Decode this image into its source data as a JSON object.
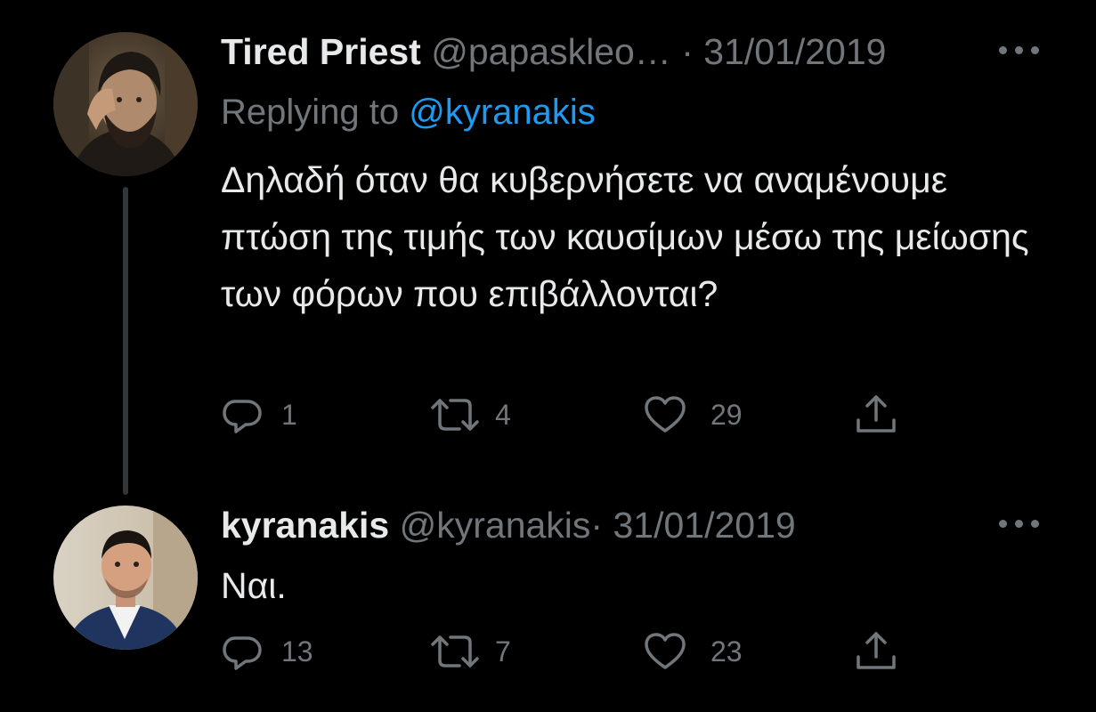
{
  "colors": {
    "background": "#000000",
    "text_primary": "#e7e9ea",
    "text_secondary": "#71767b",
    "link": "#1d9bf0",
    "thread_line": "#333639"
  },
  "tweets": [
    {
      "display_name": "Tired Priest",
      "handle": "@papaskleo…",
      "separator": "·",
      "date": "31/01/2019",
      "replying_prefix": "Replying to",
      "replying_mention": "@kyranakis",
      "text": "Δηλαδή όταν θα κυβερνήσετε να αναμένουμε πτώση της τιμής των καυσίμων μέσω της μείωσης των φόρων που επιβάλλονται?",
      "actions": {
        "reply_icon": "reply-bubble-icon",
        "reply_count": "1",
        "retweet_icon": "retweet-icon",
        "retweet_count": "4",
        "like_icon": "heart-icon",
        "like_count": "29",
        "share_icon": "share-upload-icon"
      },
      "more_icon": "more-dots-icon"
    },
    {
      "display_name": "kyranakis",
      "handle": "@kyranakis",
      "separator": "·",
      "date": "31/01/2019",
      "text": "Ναι.",
      "actions": {
        "reply_icon": "reply-bubble-icon",
        "reply_count": "13",
        "retweet_icon": "retweet-icon",
        "retweet_count": "7",
        "like_icon": "heart-icon",
        "like_count": "23",
        "share_icon": "share-upload-icon"
      },
      "more_icon": "more-dots-icon"
    }
  ]
}
